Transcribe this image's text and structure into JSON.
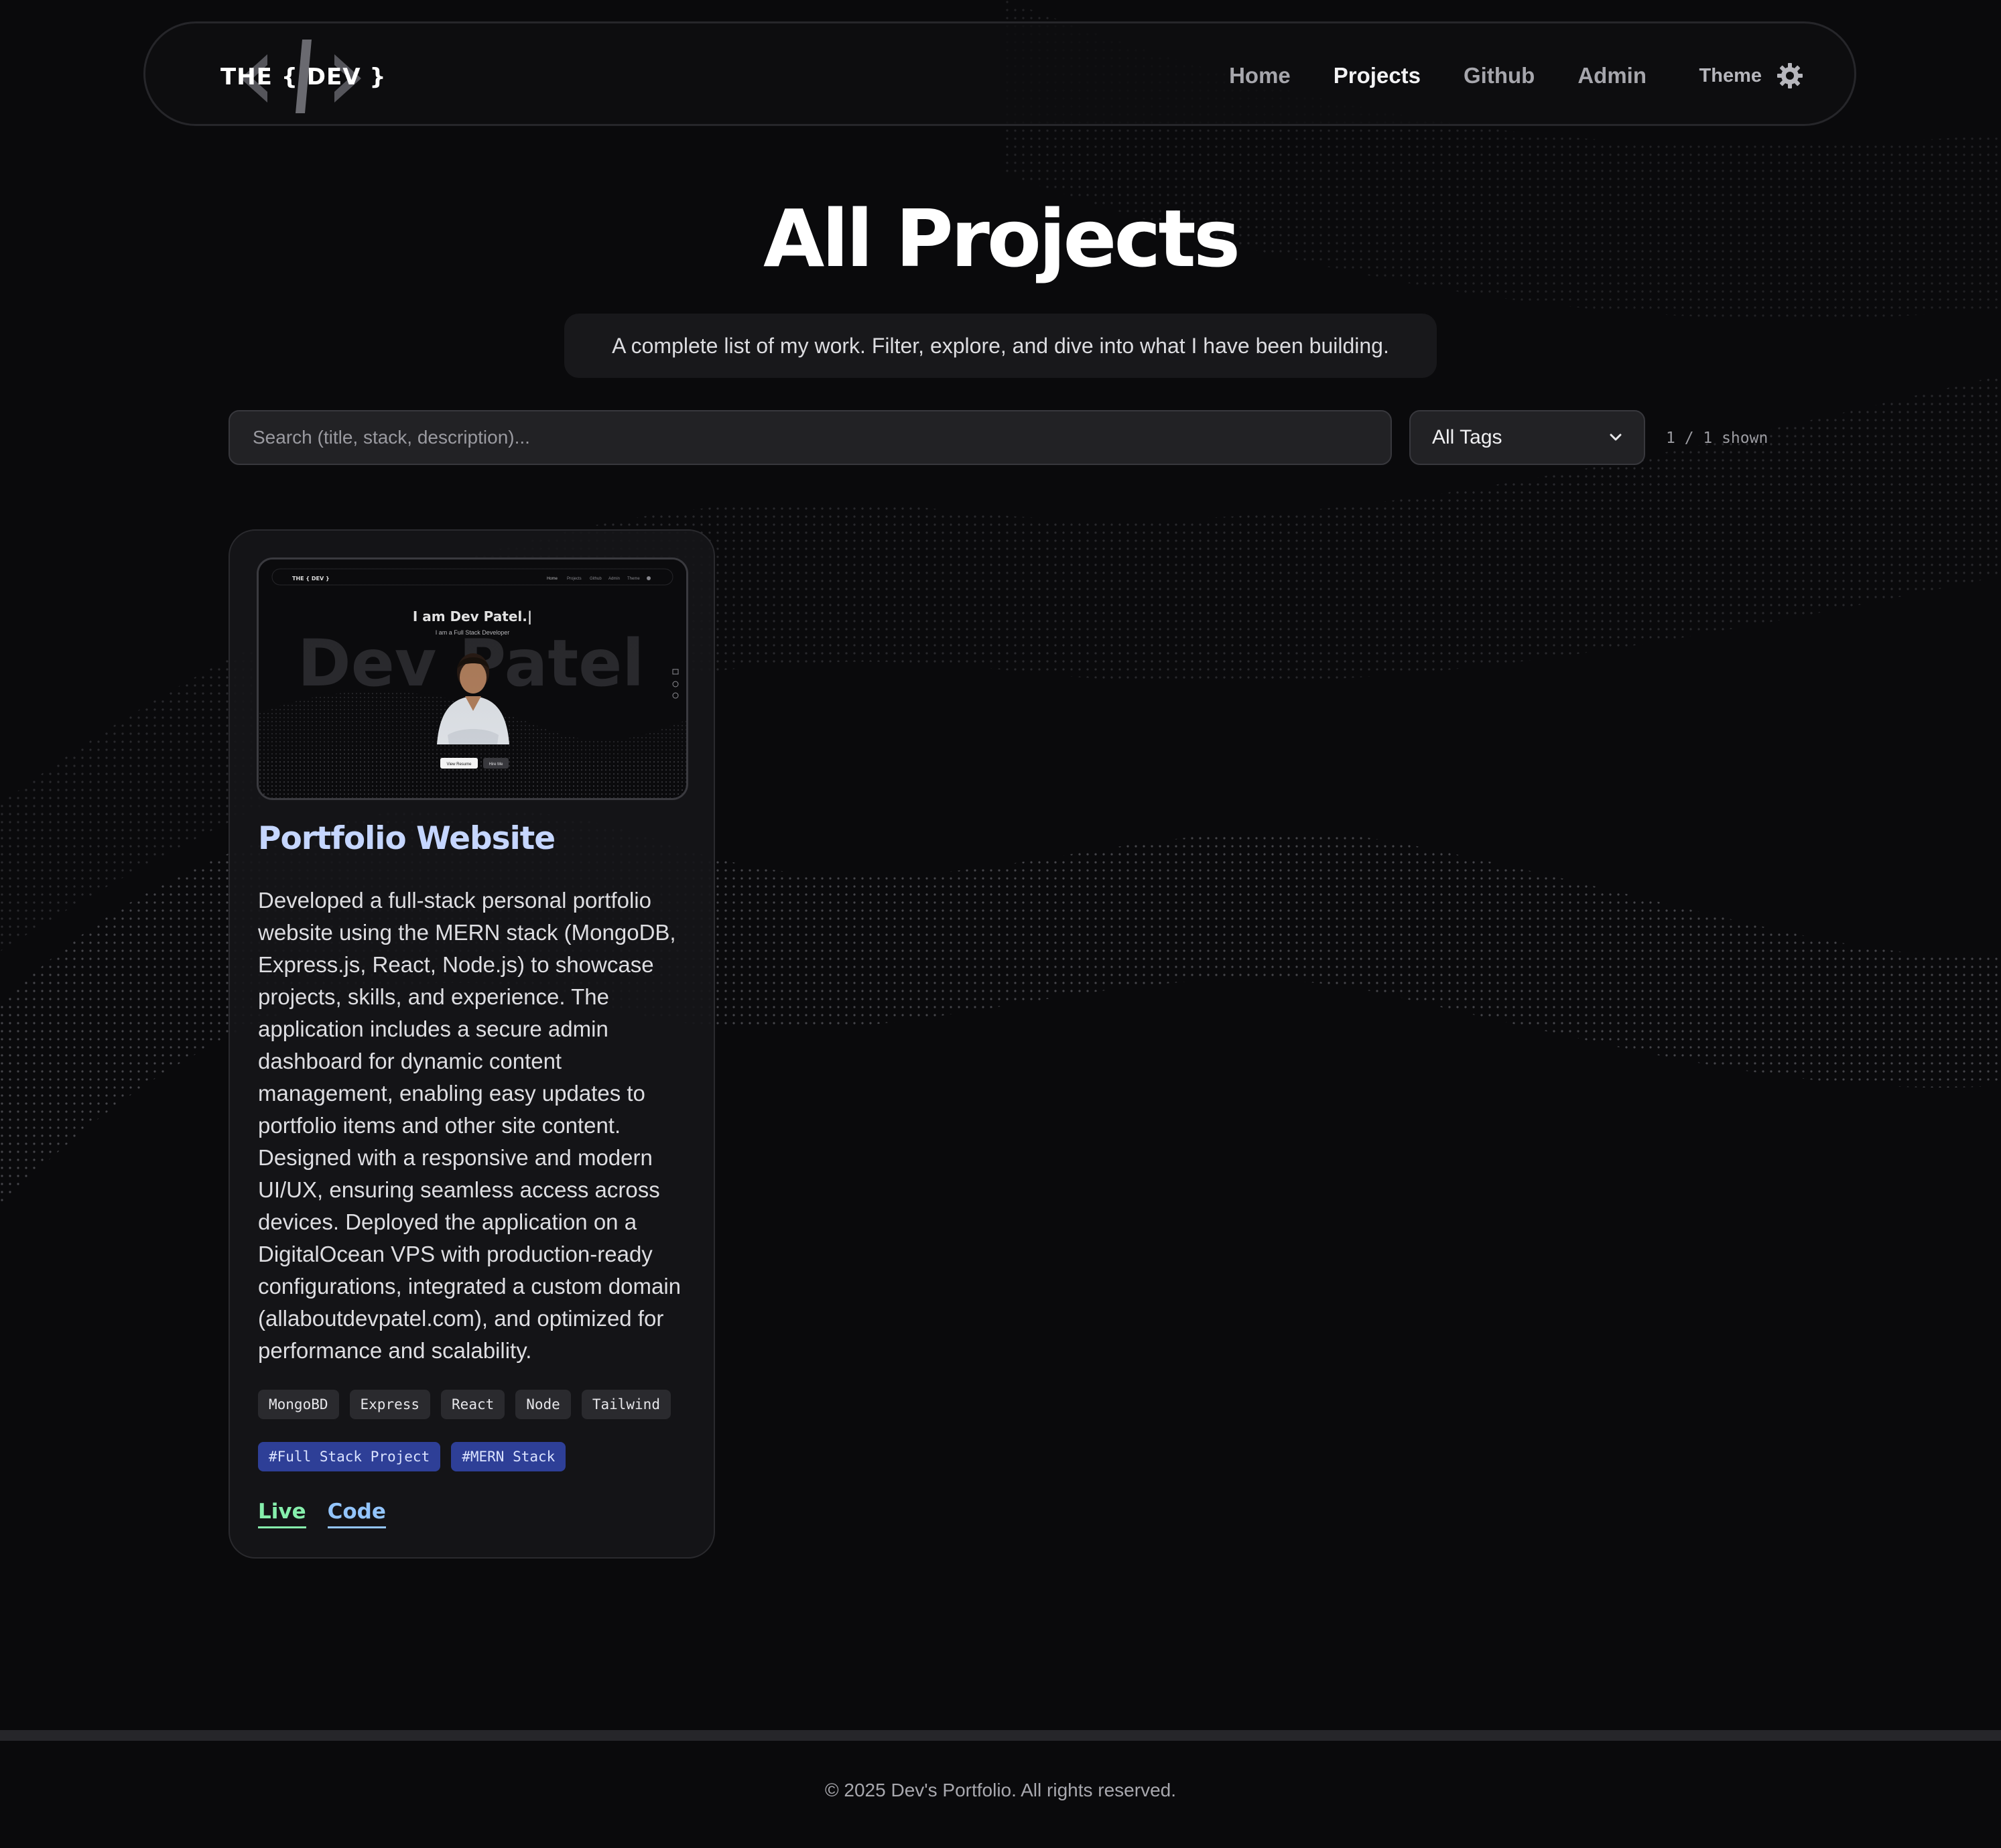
{
  "nav": {
    "logo_text": "THE { DEV }",
    "links": [
      "Home",
      "Projects",
      "Github",
      "Admin"
    ],
    "active_link": "Projects",
    "theme_label": "Theme",
    "theme_icon": "gear-icon"
  },
  "header": {
    "title": "All Projects",
    "subtitle": "A complete list of my work. Filter, explore, and dive into what I have been building."
  },
  "filters": {
    "search_placeholder": "Search (title, stack, description)...",
    "search_value": "",
    "tag_select_value": "All Tags",
    "count_text": "1 / 1 shown"
  },
  "projects": [
    {
      "title": "Portfolio Website",
      "description": "Developed a full-stack personal portfolio website using the MERN stack (MongoDB, Express.js, React, Node.js) to showcase projects, skills, and experience. The application includes a secure admin dashboard for dynamic content management, enabling easy updates to portfolio items and other site content. Designed with a responsive and modern UI/UX, ensuring seamless access across devices. Deployed the application on a DigitalOcean VPS with production-ready configurations, integrated a custom domain (allaboutdevpatel.com), and optimized for performance and scalability.",
      "stack": [
        "MongoBD",
        "Express",
        "React",
        "Node",
        "Tailwind"
      ],
      "tags": [
        "#Full Stack Project",
        "#MERN Stack"
      ],
      "live_label": "Live",
      "code_label": "Code",
      "thumbnail": {
        "logo_text": "THE { DEV }",
        "nav_links": [
          "Home",
          "Projects",
          "Github",
          "Admin",
          "Theme"
        ],
        "headline": "I am Dev Patel.|",
        "subline": "I am a Full Stack Developer",
        "bg_name": "Dev Patel",
        "button_primary": "View Resume",
        "button_secondary": "Hire Me"
      }
    }
  ],
  "footer": {
    "text": "© 2025 Dev's Portfolio. All rights reserved."
  },
  "colors": {
    "background": "#0a0a0c",
    "card_title": "#c5d6ff",
    "tag_chip": "#2e3f97",
    "live_link": "#86efac",
    "code_link": "#93c5fd"
  }
}
